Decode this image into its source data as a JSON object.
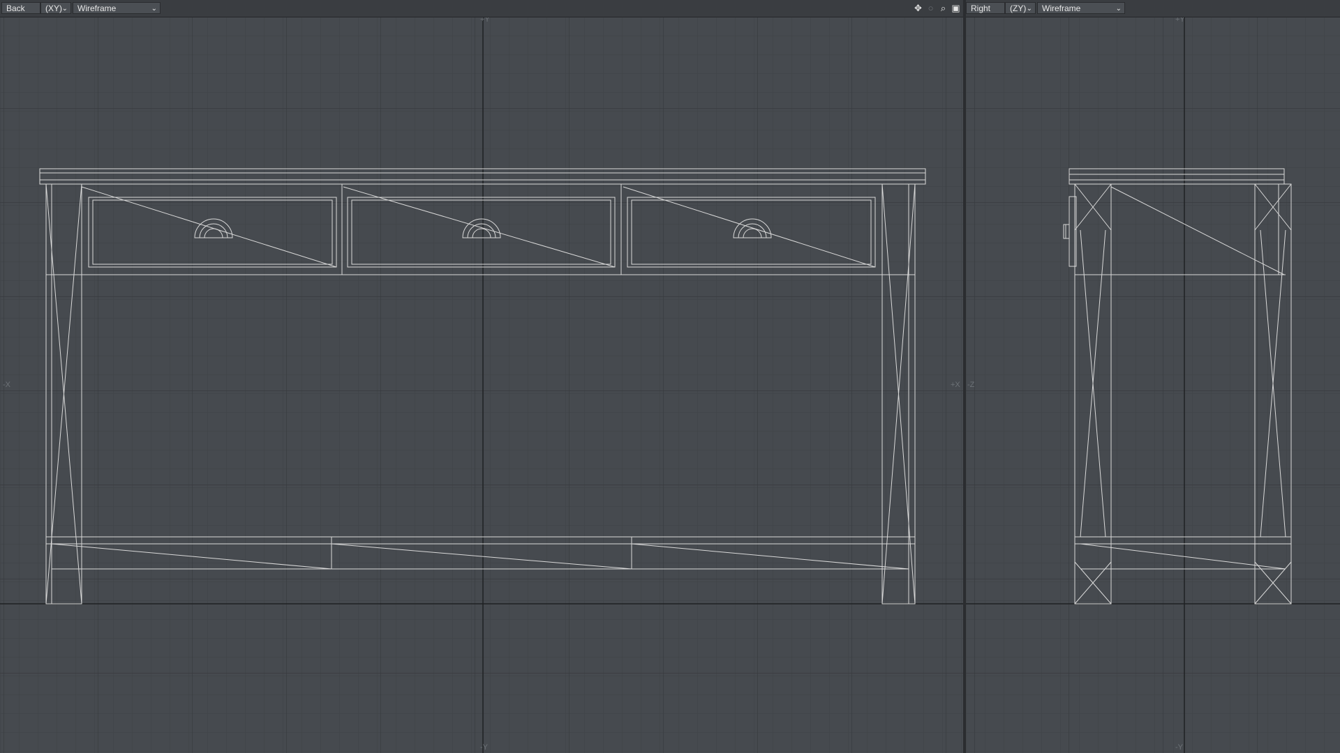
{
  "viewports": [
    {
      "view": "Back",
      "axes": "(XY)",
      "mode": "Wireframe",
      "axis_labels": {
        "top": "+Y",
        "bottom": "-Y",
        "left": "-X",
        "right": "+X"
      }
    },
    {
      "view": "Right",
      "axes": "(ZY)",
      "mode": "Wireframe",
      "axis_labels": {
        "top": "+Y",
        "bottom": "-Y",
        "left": "-Z"
      }
    }
  ],
  "icons": [
    "move-icon",
    "rotate-icon",
    "zoom-icon",
    "maximize-icon"
  ],
  "colors": {
    "grid_bg": "#464a4f",
    "grid_line": "#3d4044",
    "grid_major": "#34373a",
    "axis": "#1f2123",
    "wire": "#d9d9d9"
  }
}
